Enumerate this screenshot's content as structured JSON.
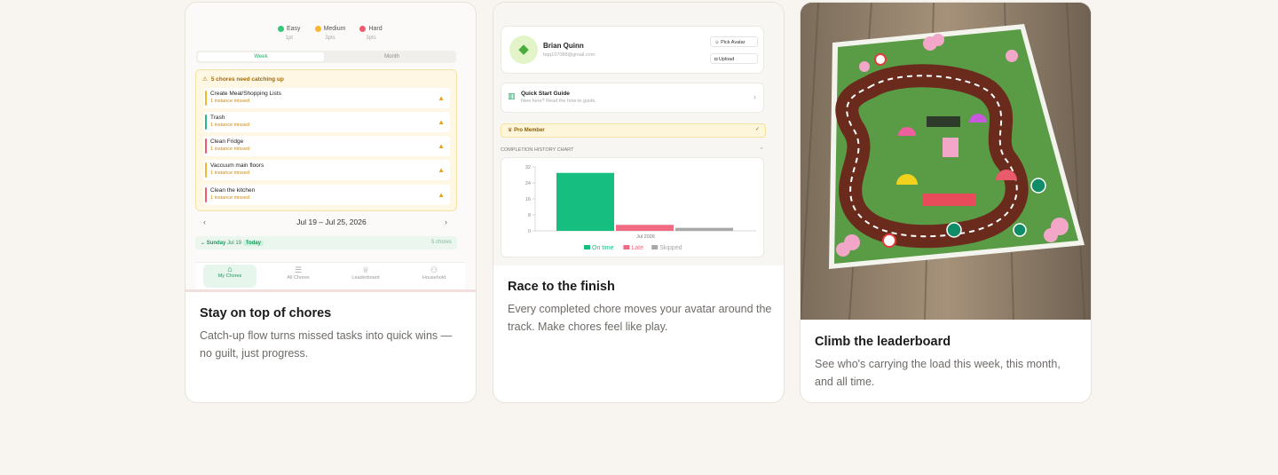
{
  "cards": [
    {
      "title": "Stay on top of chores",
      "description": "Catch-up flow turns missed tasks into quick wins — no guilt, just progress.",
      "screenshot": {
        "legend": [
          {
            "label": "Easy",
            "points": "1pt",
            "color": "#34c77b"
          },
          {
            "label": "Medium",
            "points": "3pts",
            "color": "#f5b82e"
          },
          {
            "label": "Hard",
            "points": "3pts",
            "color": "#ef5a6f"
          }
        ],
        "segments": {
          "active": "Week",
          "inactive": "Month"
        },
        "catch_up_header": "5 chores need catching up",
        "chores": [
          {
            "name": "Create Meal/Shopping Lists",
            "missed": "1 instance missed",
            "color": "#f1b82d"
          },
          {
            "name": "Trash",
            "missed": "1 instance missed",
            "color": "#26b98a"
          },
          {
            "name": "Clean Fridge",
            "missed": "1 instance missed",
            "color": "#ef5a6f"
          },
          {
            "name": "Vaccuum main floors",
            "missed": "1 instance missed",
            "color": "#f1b82d"
          },
          {
            "name": "Clean the kitchen",
            "missed": "1 instance missed",
            "color": "#ef5a6f"
          }
        ],
        "date_range": "Jul 19 – Jul 25, 2026",
        "prev_icon": "chevron-left-icon",
        "next_icon": "chevron-right-icon",
        "day": {
          "name": "Sunday",
          "date": "Jul 19",
          "badge": "Today",
          "count": "5 chores"
        },
        "tabs": [
          {
            "label": "My Chores",
            "icon": "home-icon",
            "active": true
          },
          {
            "label": "All Chores",
            "icon": "list-icon",
            "active": false
          },
          {
            "label": "Leaderboard",
            "icon": "trophy-icon",
            "active": false
          },
          {
            "label": "Household",
            "icon": "users-icon",
            "active": false
          }
        ]
      }
    },
    {
      "title": "Race to the finish",
      "description": "Every completed chore moves your avatar around the track. Make chores feel like play.",
      "screenshot": {
        "profile": {
          "name": "Brian Quinn",
          "email": "bqq107088@gmail.com",
          "pick_avatar": "Pick Avatar",
          "upload": "Upload"
        },
        "guide": {
          "title": "Quick Start Guide",
          "subtitle": "New here? Read the how-to guide."
        },
        "pro_label": "Pro Member",
        "chart_section_title": "COMPLETION HISTORY CHART"
      }
    },
    {
      "title": "Climb the leaderboard",
      "description": "See who's carrying the load this week, this month, and all time.",
      "screenshot": {
        "image": "race-track-board-photo"
      }
    }
  ],
  "chart_data": {
    "type": "bar",
    "categories": [
      "Jul 2026"
    ],
    "series": [
      {
        "name": "On time",
        "values": [
          29
        ],
        "color": "#16bf7f"
      },
      {
        "name": "Late",
        "values": [
          3
        ],
        "color": "#ef6a82"
      },
      {
        "name": "Skipped",
        "values": [
          1.5
        ],
        "color": "#a8a8a8"
      }
    ],
    "yticks": [
      0,
      8,
      16,
      24,
      32
    ],
    "ylim": [
      0,
      32
    ],
    "xlabel": "",
    "ylabel": "",
    "legend": "bottom"
  }
}
